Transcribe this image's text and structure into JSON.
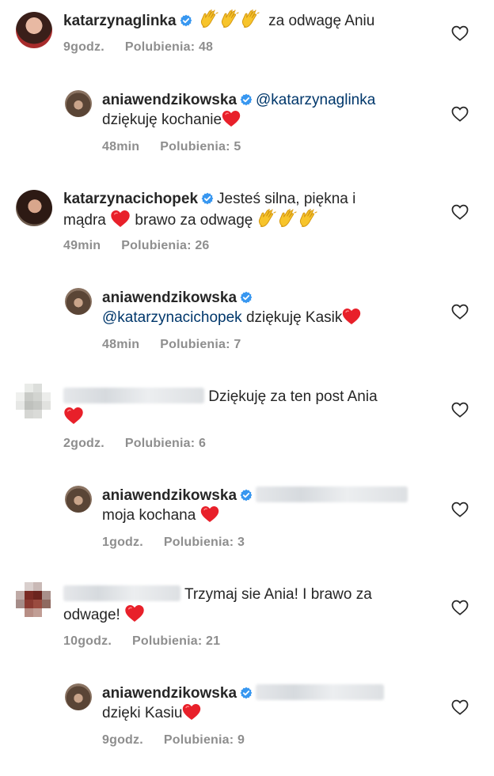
{
  "comments": [
    {
      "user": "katarzynaglinka",
      "text": "za odwagę Aniu",
      "time": "9godz.",
      "likes": "Polubienia: 48",
      "reply": {
        "user": "aniawendzikowska",
        "mention": "@katarzynaglinka",
        "text": "dziękuję kochanie",
        "time": "48min",
        "likes": "Polubienia: 5"
      }
    },
    {
      "user": "katarzynacichopek",
      "text_line1": "Jesteś silna, piękna i",
      "text_line2a": "mądra",
      "text_line2b": "brawo za odwagę",
      "time": "49min",
      "likes": "Polubienia: 26",
      "reply": {
        "user": "aniawendzikowska",
        "mention": "@katarzynacichopek",
        "text": "dziękuję Kasik",
        "time": "48min",
        "likes": "Polubienia: 7"
      }
    },
    {
      "user": "",
      "text": "Dziękuję za ten post Ania",
      "time": "2godz.",
      "likes": "Polubienia: 6",
      "reply": {
        "user": "aniawendzikowska",
        "text": "moja kochana",
        "time": "1godz.",
        "likes": "Polubienia: 3"
      }
    },
    {
      "user": "",
      "text_line1": "Trzymaj sie Ania! I brawo za",
      "text_line2": "odwage!",
      "time": "10godz.",
      "likes": "Polubienia: 21",
      "reply": {
        "user": "aniawendzikowska",
        "text": "dzięki Kasiu",
        "time": "9godz.",
        "likes": "Polubienia: 9"
      }
    }
  ],
  "colors": {
    "verified": "#3897f0",
    "heart": "#ed1c24",
    "mention": "#00376b",
    "meta": "#8e8e8e"
  },
  "icons": {
    "like": "heart-outline-icon",
    "verified": "verified-badge-icon",
    "clap": "clapping-hands-emoji",
    "heart": "red-heart-emoji"
  }
}
